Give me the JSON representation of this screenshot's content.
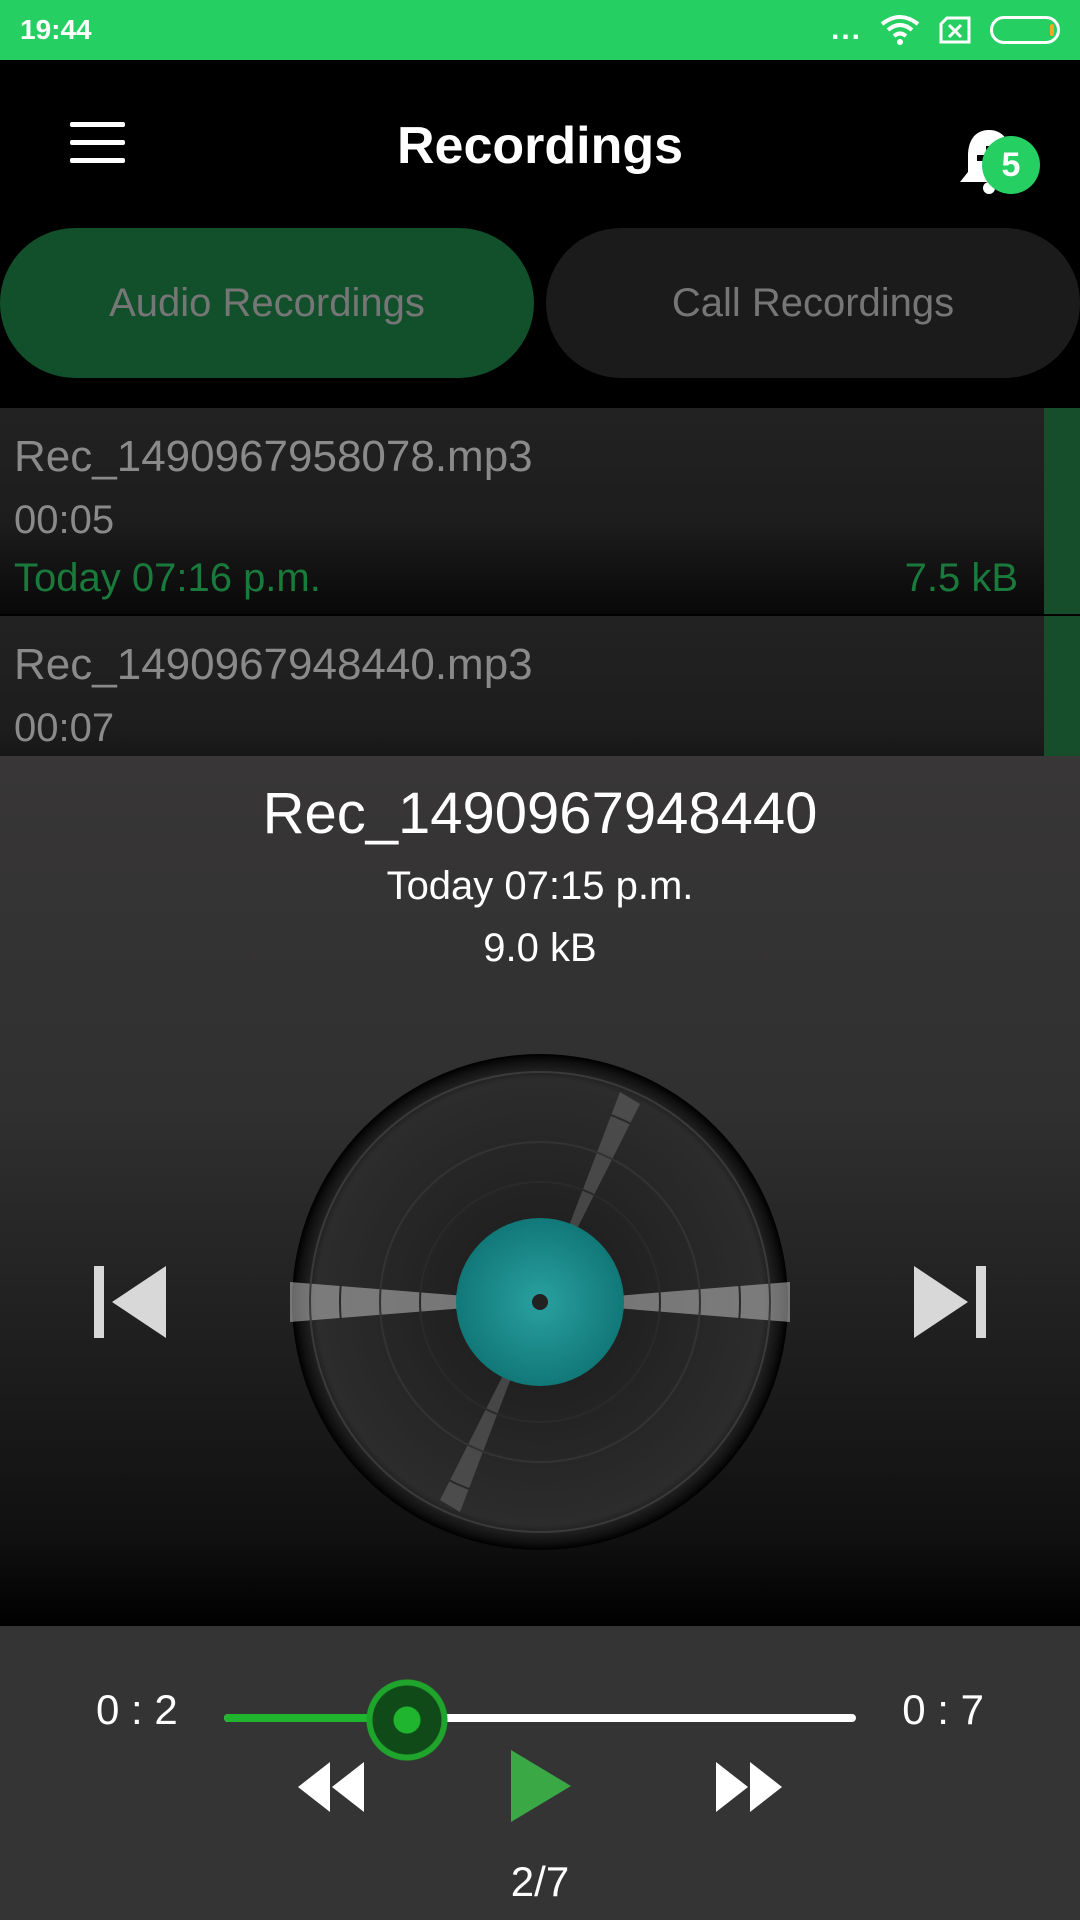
{
  "status_bar": {
    "time": "19:44",
    "dots": "...",
    "battery_accent": "#f5a623"
  },
  "app_bar": {
    "title": "Recordings",
    "menu_icon": "hamburger-menu-icon",
    "bell_icon": "bell-plus-icon",
    "badge_count": "5"
  },
  "tabs": [
    {
      "label": "Audio Recordings",
      "active": true
    },
    {
      "label": "Call Recordings",
      "active": false
    }
  ],
  "recordings": [
    {
      "name": "Rec_1490967958078.mp3",
      "duration": "00:05",
      "date": "Today 07:16 p.m.",
      "size": "7.5 kB"
    },
    {
      "name": "Rec_1490967948440.mp3",
      "duration": "00:07"
    }
  ],
  "player": {
    "title": "Rec_1490967948440",
    "date": "Today 07:15 p.m.",
    "size": "9.0 kB",
    "current_time": "0 : 2",
    "total_time": "0 : 7",
    "progress": 0.29,
    "counter": "2/7"
  },
  "colors": {
    "brand": "#26cf62",
    "accent_dark": "#11502b",
    "label_green": "#1a7a3c",
    "seek_green": "#1fb52f"
  }
}
